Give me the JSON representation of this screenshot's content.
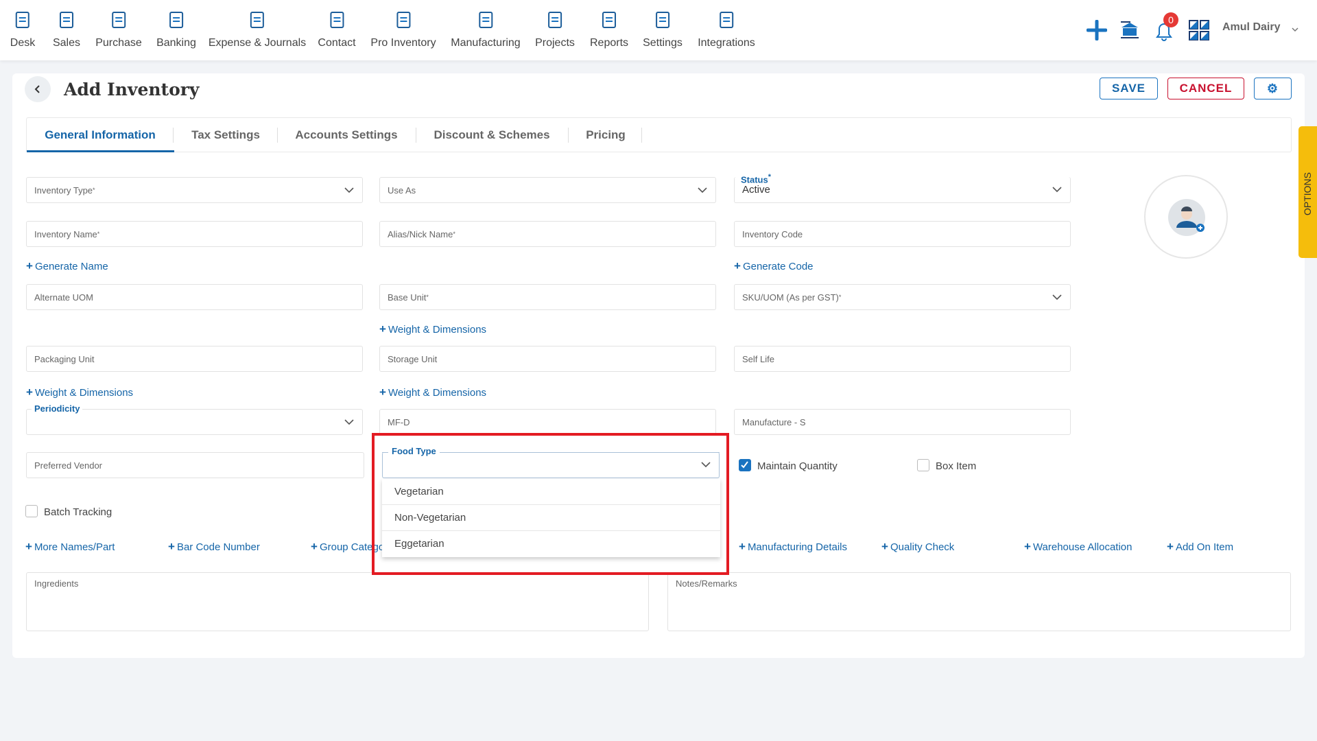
{
  "nav": {
    "items": [
      {
        "label": "Desk",
        "icon": "desk-icon"
      },
      {
        "label": "Sales",
        "icon": "sales-icon"
      },
      {
        "label": "Purchase",
        "icon": "cart-icon"
      },
      {
        "label": "Banking",
        "icon": "bank-icon"
      },
      {
        "label": "Expense & Journals",
        "icon": "journal-icon"
      },
      {
        "label": "Contact",
        "icon": "contact-icon"
      },
      {
        "label": "Pro Inventory",
        "icon": "inventory-icon"
      },
      {
        "label": "Manufacturing",
        "icon": "manufacturing-icon"
      },
      {
        "label": "Projects",
        "icon": "projects-icon"
      },
      {
        "label": "Reports",
        "icon": "reports-icon"
      },
      {
        "label": "Settings",
        "icon": "settings-icon"
      },
      {
        "label": "Integrations",
        "icon": "integrations-icon"
      }
    ],
    "notifications": "0",
    "company": "Amul Dairy"
  },
  "page": {
    "title": "Add Inventory",
    "save": "SAVE",
    "cancel": "CANCEL",
    "options": "OPTIONS"
  },
  "tabs": [
    "General Information",
    "Tax Settings",
    "Accounts Settings",
    "Discount & Schemes",
    "Pricing"
  ],
  "form": {
    "inventory_type": "Inventory Type",
    "use_as": "Use As",
    "status_label": "Status",
    "status_value": "Active",
    "inventory_name": "Inventory Name",
    "alias": "Alias/Nick Name",
    "inventory_code": "Inventory Code",
    "generate_name": "Generate Name",
    "generate_code": "Generate Code",
    "alternate_uom": "Alternate UOM",
    "base_unit": "Base Unit",
    "sku_uom": "SKU/UOM (As per GST)",
    "weight_dimensions": "Weight & Dimensions",
    "packaging_unit": "Packaging Unit",
    "storage_unit": "Storage Unit",
    "self_life": "Self Life",
    "periodicity": "Periodicity",
    "mfd": "MF-D",
    "manufacture": "Manufacture - S",
    "preferred_vendor": "Preferred Vendor",
    "food_type": "Food Type",
    "food_type_options": [
      "Vegetarian",
      "Non-Vegetarian",
      "Eggetarian"
    ],
    "maintain_quantity": "Maintain Quantity",
    "maintain_quantity_checked": true,
    "box_item": "Box Item",
    "box_item_checked": false,
    "batch_tracking": "Batch Tracking",
    "batch_tracking_checked": false,
    "links": [
      "More Names/Part",
      "Bar Code Number",
      "Group Category",
      "Manufacturing Details",
      "Quality Check",
      "Warehouse Allocation",
      "Add On Item"
    ],
    "ingredients": "Ingredients",
    "notes": "Notes/Remarks"
  },
  "colors": {
    "accent": "#1565a8",
    "cancel": "#c8102e",
    "highlight": "#e31b23",
    "options_tab": "#f5bd0c"
  }
}
